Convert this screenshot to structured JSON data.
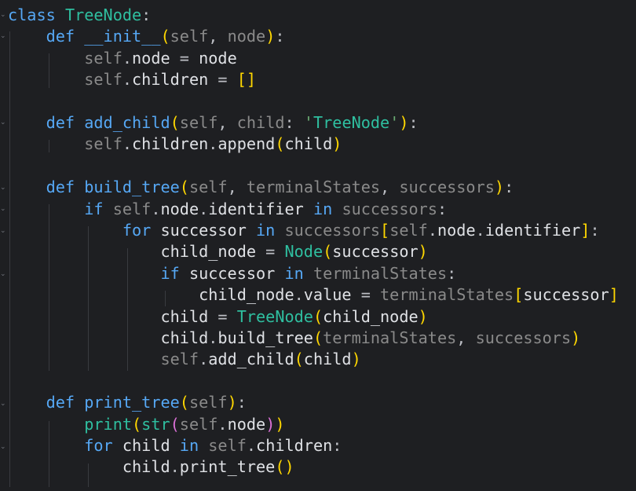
{
  "editor": {
    "language": "python",
    "theme_background": "#1e1f22",
    "lines": [
      "class TreeNode:",
      "    def __init__(self, node):",
      "        self.node = node",
      "        self.children = []",
      "",
      "    def add_child(self, child: 'TreeNode'):",
      "        self.children.append(child)",
      "",
      "    def build_tree(self, terminalStates, successors):",
      "        if self.node.identifier in successors:",
      "            for successor in successors[self.node.identifier]:",
      "                child_node = Node(successor)",
      "                if successor in terminalStates:",
      "                    child_node.value = terminalStates[successor]",
      "                child = TreeNode(child_node)",
      "                child.build_tree(terminalStates, successors)",
      "                self.add_child(child)",
      "",
      "    def print_tree(self):",
      "        print(str(self.node))",
      "        for child in self.children:",
      "            child.print_tree()"
    ]
  }
}
